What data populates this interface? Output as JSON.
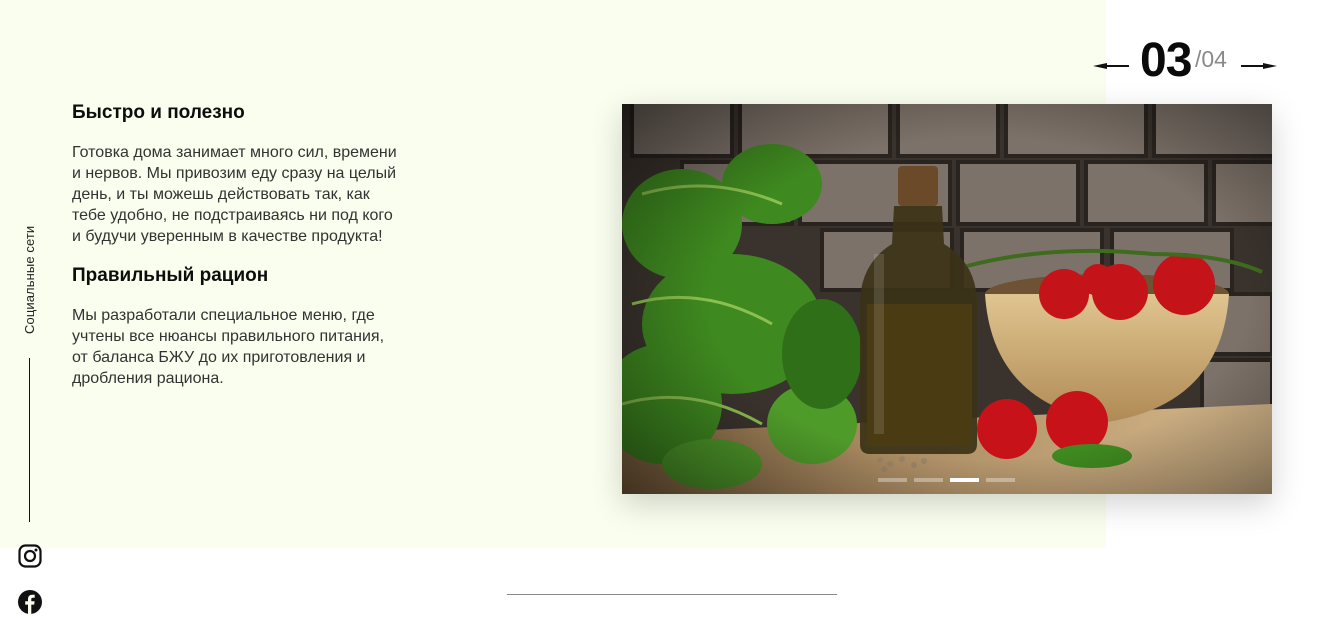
{
  "content": {
    "sections": [
      {
        "heading": "Быстро и полезно",
        "text": "Готовка дома занимает много сил, времени и нервов. Мы привозим еду сразу на целый день, и ты можешь действовать так, как тебе удобно, не подстраиваясь ни под кого и будучи уверенным в качестве продукта!"
      },
      {
        "heading": "Правильный рацион",
        "text": "Мы разработали специальное меню, где учтены все нюансы правильного питания, от баланса БЖУ до их приготовления и дробления рациона."
      }
    ]
  },
  "sidebar": {
    "label": "Социальные сети",
    "icons": [
      "instagram-icon",
      "facebook-icon"
    ]
  },
  "slider": {
    "current": "03",
    "total": "/04",
    "active_index": 3,
    "dot_count": 4
  },
  "colors": {
    "panel_background": "#fafeee",
    "text": "#111111",
    "counter_total": "#8a8a8a"
  }
}
